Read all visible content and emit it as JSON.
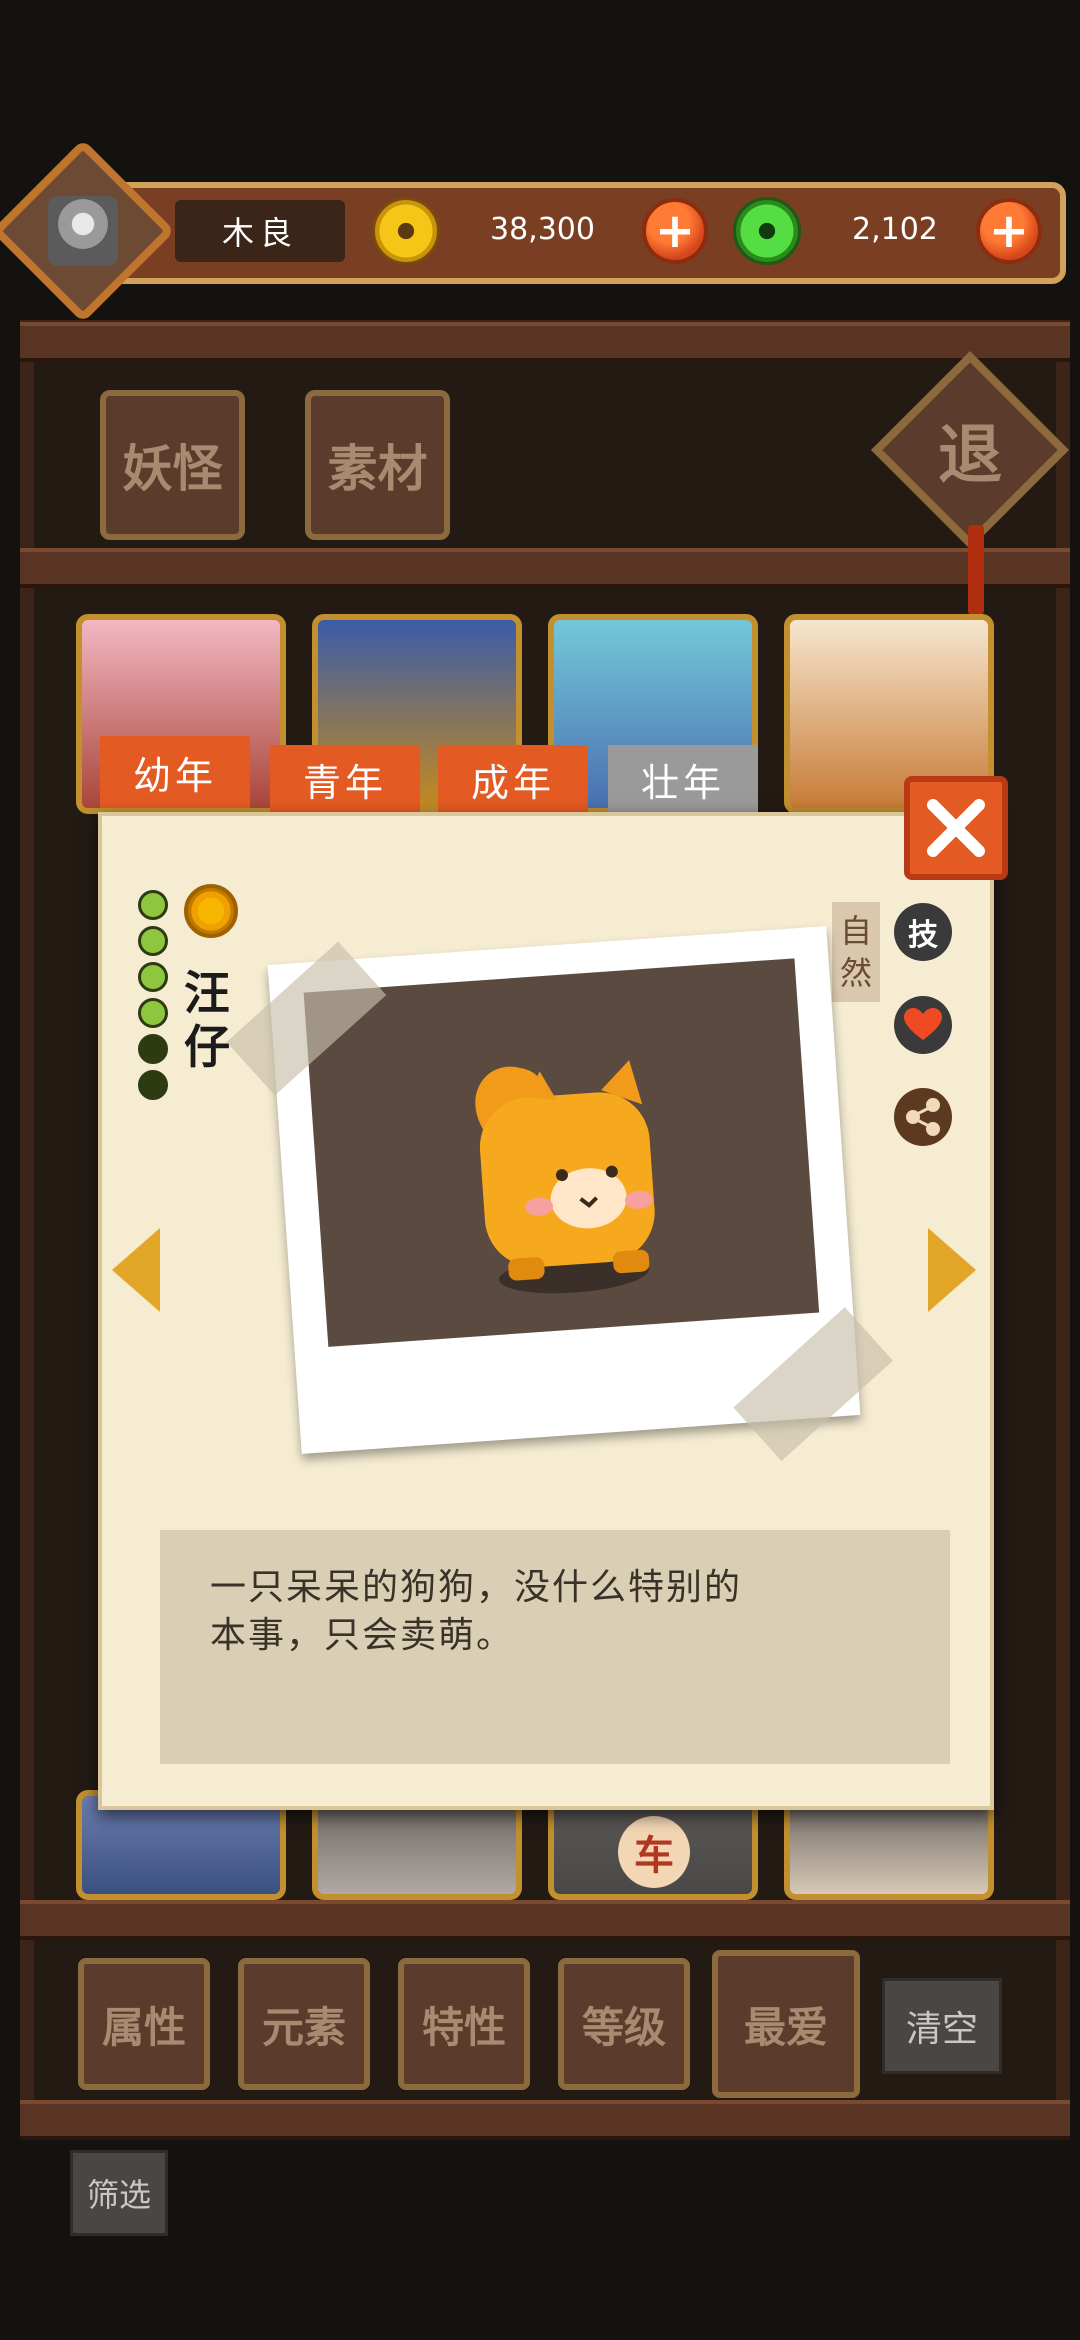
{
  "header": {
    "player_name": "木良",
    "gold": "38,300",
    "jade": "2,102",
    "plus": "+"
  },
  "shelf_tabs": [
    "妖怪",
    "素材"
  ],
  "exit_label": "退",
  "age_tabs": [
    {
      "label": "幼年",
      "active": true
    },
    {
      "label": "青年",
      "active": false
    },
    {
      "label": "成年",
      "active": false
    },
    {
      "label": "壮年",
      "active": false
    }
  ],
  "monster": {
    "name_line1": "汪",
    "name_line2": "仔",
    "element_tag_line1": "自",
    "element_tag_line2": "然",
    "skill_label": "技",
    "level_filled": 4,
    "level_total": 6,
    "description_line1": "一只呆呆的狗狗，没什么特别的",
    "description_line2": "本事，只会卖萌。"
  },
  "card_badge": "车",
  "filters": [
    "属性",
    "元素",
    "特性",
    "等级",
    "最爱"
  ],
  "clear_label": "清空",
  "sift_label": "筛选",
  "colors": {
    "accent_orange": "#e35a23",
    "inactive_tab": "#9a9a9a",
    "panel_bg": "#f5ecd2"
  }
}
